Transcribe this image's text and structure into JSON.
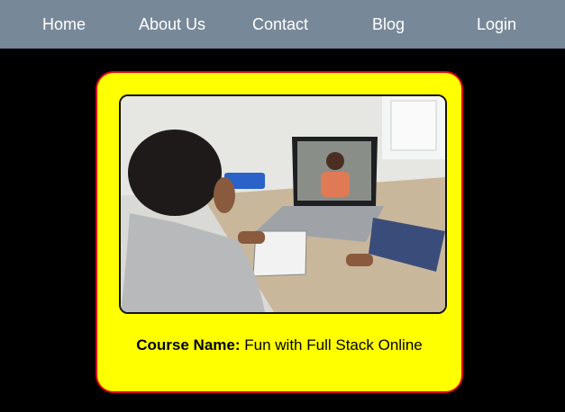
{
  "nav": {
    "items": [
      {
        "label": "Home"
      },
      {
        "label": "About Us"
      },
      {
        "label": "Contact"
      },
      {
        "label": "Blog"
      },
      {
        "label": "Login"
      }
    ]
  },
  "card": {
    "image_icon": "photo-icon",
    "course_label": "Course Name:",
    "course_name": "Fun with Full Stack Online"
  },
  "colors": {
    "navbar": "#778899",
    "background": "#000000",
    "card": "#ffff00",
    "card_border": "#e0001a"
  }
}
